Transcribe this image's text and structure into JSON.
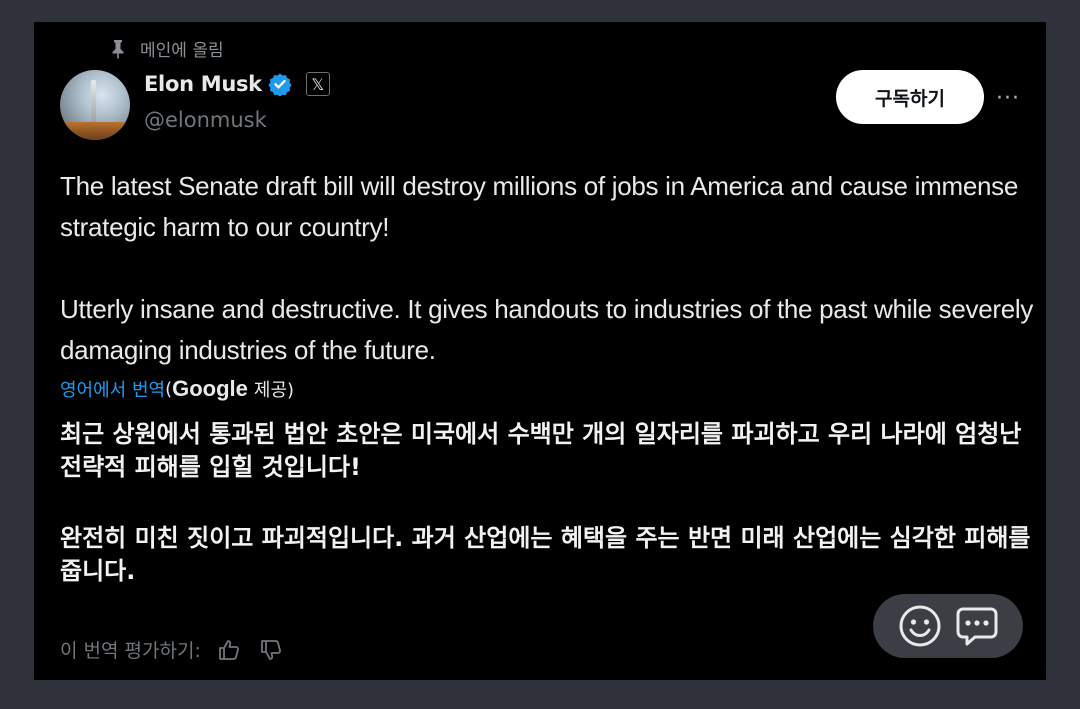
{
  "post": {
    "pinned_label": "메인에 올림",
    "author": {
      "display_name": "Elon Musk",
      "handle": "@elonmusk",
      "affiliate_badge": "𝕏"
    },
    "subscribe_label": "구독하기",
    "more_label": "···",
    "original_text": [
      "The latest Senate draft bill will destroy millions of jobs in America and cause immense strategic harm to our country!",
      "Utterly insane and destructive. It gives handouts to industries of the past while severely damaging industries of the future."
    ],
    "translation": {
      "link_label": "영어에서 번역",
      "open_paren": "(",
      "provider": "Google",
      "provided_label": "제공)",
      "text": [
        "최근 상원에서 통과된 법안 초안은 미국에서 수백만 개의 일자리를 파괴하고 우리 나라에 엄청난 전략적 피해를 입힐 것입니다!",
        "완전히 미친 짓이고 파괴적입니다. 과거 산업에는 혜택을 주는 반면 미래 산업에는 심각한 피해를 줍니다."
      ],
      "rate_label": "이 번역 평가하기:"
    }
  },
  "icons": {
    "pin": "pin-icon",
    "verified": "verified-badge-icon",
    "thumbs_up": "thumbs-up-icon",
    "thumbs_down": "thumbs-down-icon",
    "emoji": "smiley-icon",
    "chat": "chat-bubble-icon"
  },
  "colors": {
    "page_bg": "#2f323a",
    "card_bg": "#000000",
    "text": "#e7e9ea",
    "muted": "#71767b",
    "link": "#1d9bf0",
    "verified": "#1d9bf0"
  }
}
